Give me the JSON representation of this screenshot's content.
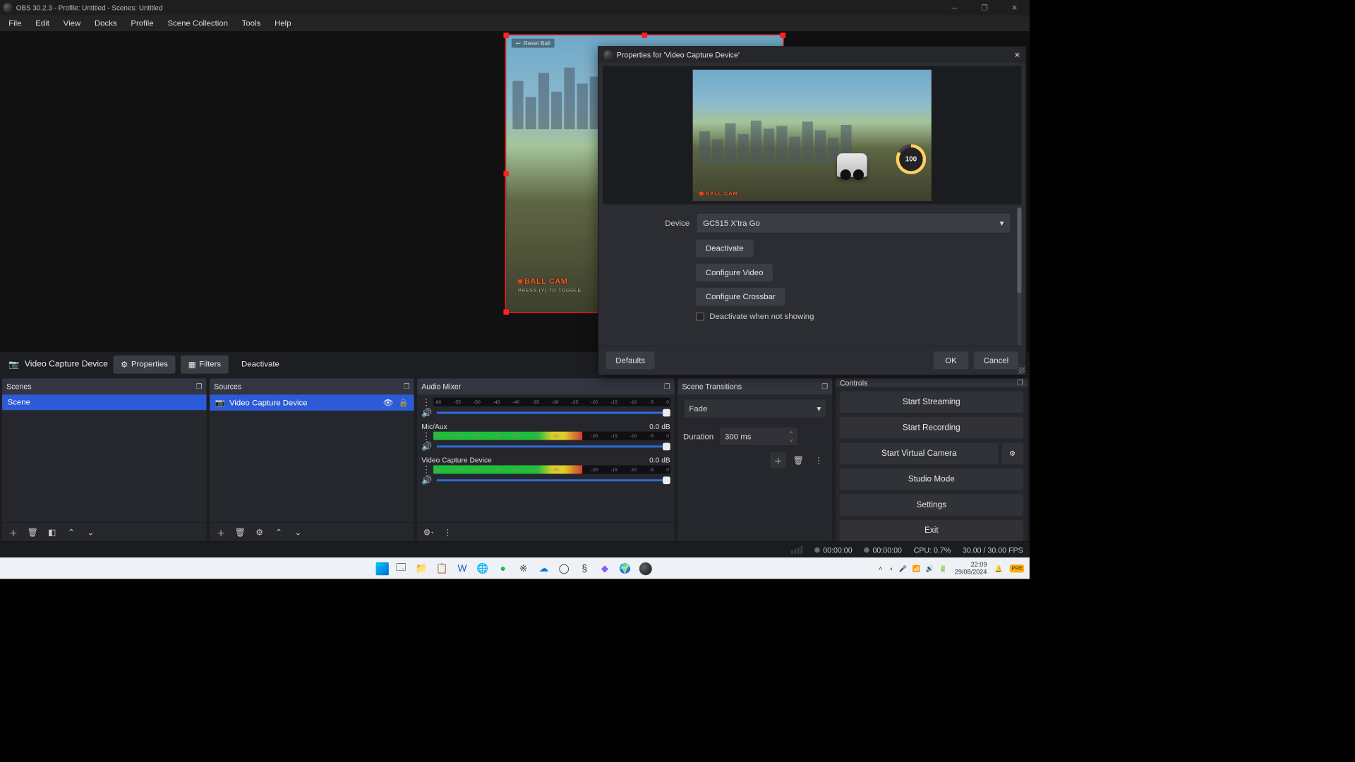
{
  "titlebar": {
    "title": "OBS 30.2.3 - Profile: Untitled - Scenes: Untitled"
  },
  "menu": [
    "File",
    "Edit",
    "View",
    "Docks",
    "Profile",
    "Scene Collection",
    "Tools",
    "Help"
  ],
  "sourcebar": {
    "icon": "camera-icon",
    "name": "Video Capture Device",
    "buttons": {
      "properties": "Properties",
      "filters": "Filters",
      "deactivate": "Deactivate"
    }
  },
  "preview": {
    "reset_ball": "Reset Ball",
    "ballcam": "BALL CAM",
    "toggle": "PRESS (Y)  TO TOGGLE",
    "boost": "100"
  },
  "properties": {
    "title": "Properties for 'Video Capture Device'",
    "device_label": "Device",
    "device_value": "GC515 X'tra Go",
    "deactivate": "Deactivate",
    "configure_video": "Configure Video",
    "configure_crossbar": "Configure Crossbar",
    "deactivate_when_not_showing": "Deactivate when not showing",
    "defaults": "Defaults",
    "ok": "OK",
    "cancel": "Cancel"
  },
  "docks": {
    "scenes": {
      "title": "Scenes",
      "items": [
        "Scene"
      ]
    },
    "sources": {
      "title": "Sources",
      "items": [
        {
          "label": "Video Capture Device"
        }
      ]
    },
    "mixer": {
      "title": "Audio Mixer",
      "ticks": [
        "-60",
        "-55",
        "-50",
        "-45",
        "-40",
        "-35",
        "-30",
        "-25",
        "-20",
        "-15",
        "-10",
        "-5",
        "0"
      ],
      "sources": [
        {
          "name": "",
          "db": ""
        },
        {
          "name": "Mic/Aux",
          "db": "0.0 dB"
        },
        {
          "name": "Video Capture Device",
          "db": "0.0 dB"
        }
      ]
    },
    "transitions": {
      "title": "Scene Transitions",
      "value": "Fade",
      "duration_label": "Duration",
      "duration": "300 ms"
    },
    "controls": {
      "title": "Controls",
      "start_streaming": "Start Streaming",
      "start_recording": "Start Recording",
      "start_virtual_camera": "Start Virtual Camera",
      "studio_mode": "Studio Mode",
      "settings": "Settings",
      "exit": "Exit"
    }
  },
  "status": {
    "timer1": "00:00:00",
    "timer2": "00:00:00",
    "cpu": "CPU: 0.7%",
    "fps": "30.00 / 30.00 FPS"
  },
  "taskbar": {
    "time": "22:09",
    "date": "29/08/2024"
  }
}
